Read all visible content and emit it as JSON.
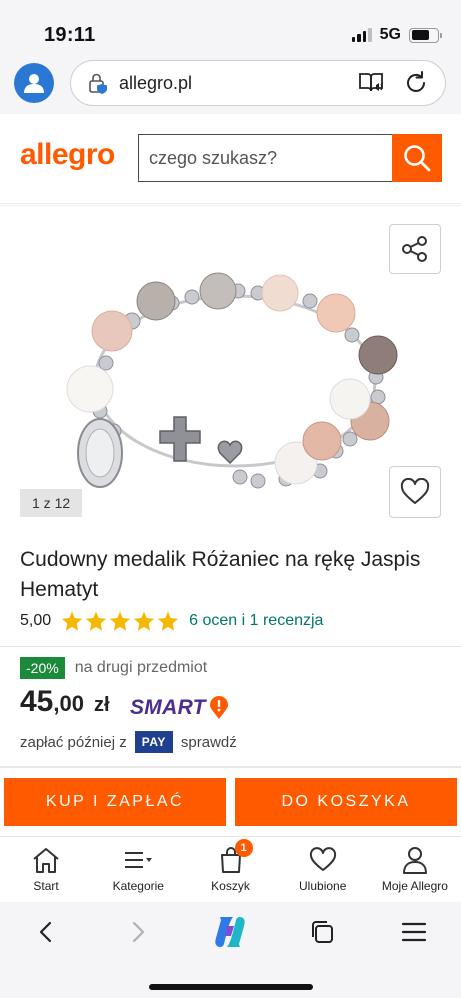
{
  "status_bar": {
    "time": "19:11",
    "network": "5G"
  },
  "browser": {
    "url": "allegro.pl"
  },
  "header": {
    "logo": "allegro",
    "search_placeholder": "czego szukasz?"
  },
  "media": {
    "counter": "1 z 12"
  },
  "product": {
    "title": "Cudowny medalik Różaniec na rękę Jaspis Hematyt",
    "rating_value": "5,00",
    "stars": 5,
    "rating_link": "6 ocen i 1 recenzja"
  },
  "price": {
    "discount_badge": "-20%",
    "discount_text": "na drugi przedmiot",
    "integer": "45",
    "decimal": ",00",
    "currency": "zł",
    "smart_label": "SMART",
    "pay_prefix": "zapłać później z",
    "pay_badge": "PAY",
    "pay_suffix": "sprawdź"
  },
  "actions": {
    "buy_label": "KUP I ZAPŁAĆ",
    "cart_label": "DO KOSZYKA"
  },
  "bottom_nav": {
    "items": [
      {
        "label": "Start",
        "icon": "home-icon"
      },
      {
        "label": "Kategorie",
        "icon": "menu-icon"
      },
      {
        "label": "Koszyk",
        "icon": "cart-icon",
        "badge": "1"
      },
      {
        "label": "Ulubione",
        "icon": "heart-icon"
      },
      {
        "label": "Moje Allegro",
        "icon": "user-icon"
      }
    ]
  },
  "colors": {
    "accent": "#ff5a00",
    "rating_link": "#00796b",
    "discount_green": "#1c8a3b",
    "smart_purple": "#4b2c8f",
    "pay_blue": "#1f3f8f",
    "star": "#f5b800"
  }
}
